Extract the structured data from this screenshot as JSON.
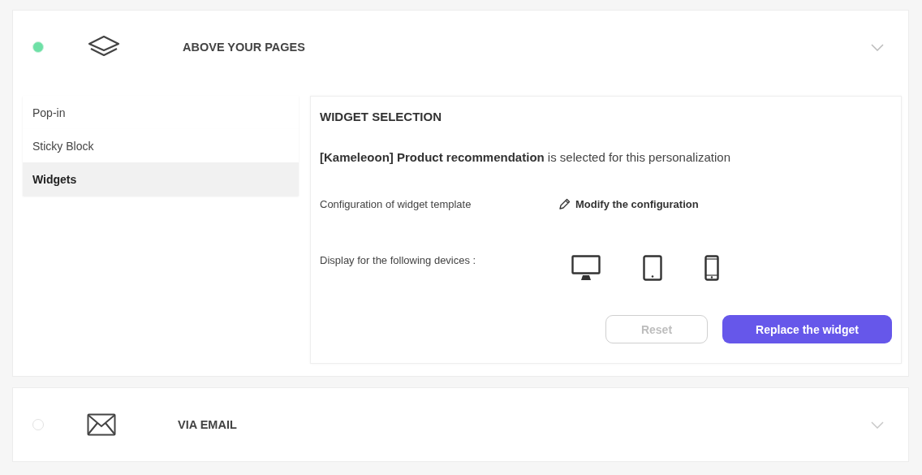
{
  "sections": [
    {
      "title": "ABOVE YOUR PAGES",
      "kind": "layers",
      "active": true,
      "expanded": true,
      "menu": [
        {
          "label": "Pop-in",
          "selected": false
        },
        {
          "label": "Sticky Block",
          "selected": false
        },
        {
          "label": "Widgets",
          "selected": true
        }
      ],
      "panel": {
        "heading": "WIDGET SELECTION",
        "selection": "**[Kameleoon] Product recommendation** is selected for this personalization",
        "config_label": "Configuration of widget template",
        "config_link": "Modify the configuration",
        "devices_label": "Display for the following devices :",
        "buttons": [
          {
            "label": "Reset",
            "kind": "secondary",
            "disabled": true
          },
          {
            "label": "Replace the widget",
            "kind": "primary",
            "disabled": false
          }
        ]
      }
    },
    {
      "title": "VIA EMAIL",
      "kind": "email",
      "active": false,
      "expanded": false
    }
  ]
}
